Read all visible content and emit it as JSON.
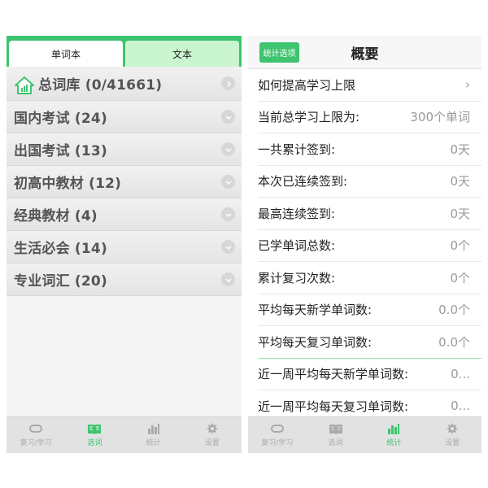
{
  "left": {
    "segments": [
      "单词本",
      "文本"
    ],
    "categories": [
      {
        "label": "总词库 (0/41661)"
      },
      {
        "label": "国内考试 (24)"
      },
      {
        "label": "出国考试 (13)"
      },
      {
        "label": "初高中教材 (12)"
      },
      {
        "label": "经典教材 (4)"
      },
      {
        "label": "生活必会 (14)"
      },
      {
        "label": "专业词汇 (20)"
      }
    ],
    "tabs": [
      {
        "label": "复习/学习",
        "icon": "loop-icon"
      },
      {
        "label": "选词",
        "icon": "book-icon"
      },
      {
        "label": "统计",
        "icon": "bar-chart-icon"
      },
      {
        "label": "设置",
        "icon": "gear-icon"
      }
    ]
  },
  "right": {
    "options_button": "统计选项",
    "title": "概要",
    "rows": [
      {
        "label": "如何提高学习上限",
        "value": "›"
      },
      {
        "label": "当前总学习上限为:",
        "value": "300个单词"
      },
      {
        "label": "一共累计签到:",
        "value": "0天"
      },
      {
        "label": "本次已连续签到:",
        "value": "0天"
      },
      {
        "label": "最高连续签到:",
        "value": "0天"
      },
      {
        "label": "已学单词总数:",
        "value": "0个"
      },
      {
        "label": "累计复习次数:",
        "value": "0个"
      },
      {
        "label": "平均每天新学单词数:",
        "value": "0.0个"
      },
      {
        "label": "平均每天复习单词数:",
        "value": "0.0个"
      },
      {
        "label": "近一周平均每天新学单词数:",
        "value": "0..."
      },
      {
        "label": "近一周平均每天复习单词数:",
        "value": "0..."
      }
    ],
    "tabs": [
      {
        "label": "复习/学习",
        "icon": "loop-icon"
      },
      {
        "label": "选词",
        "icon": "book-icon"
      },
      {
        "label": "统计",
        "icon": "bar-chart-icon"
      },
      {
        "label": "设置",
        "icon": "gear-icon"
      }
    ]
  },
  "colors": {
    "accent": "#3ec46e",
    "segment_inactive": "#c9f5cf",
    "tab_inactive": "#aaaaaa"
  }
}
